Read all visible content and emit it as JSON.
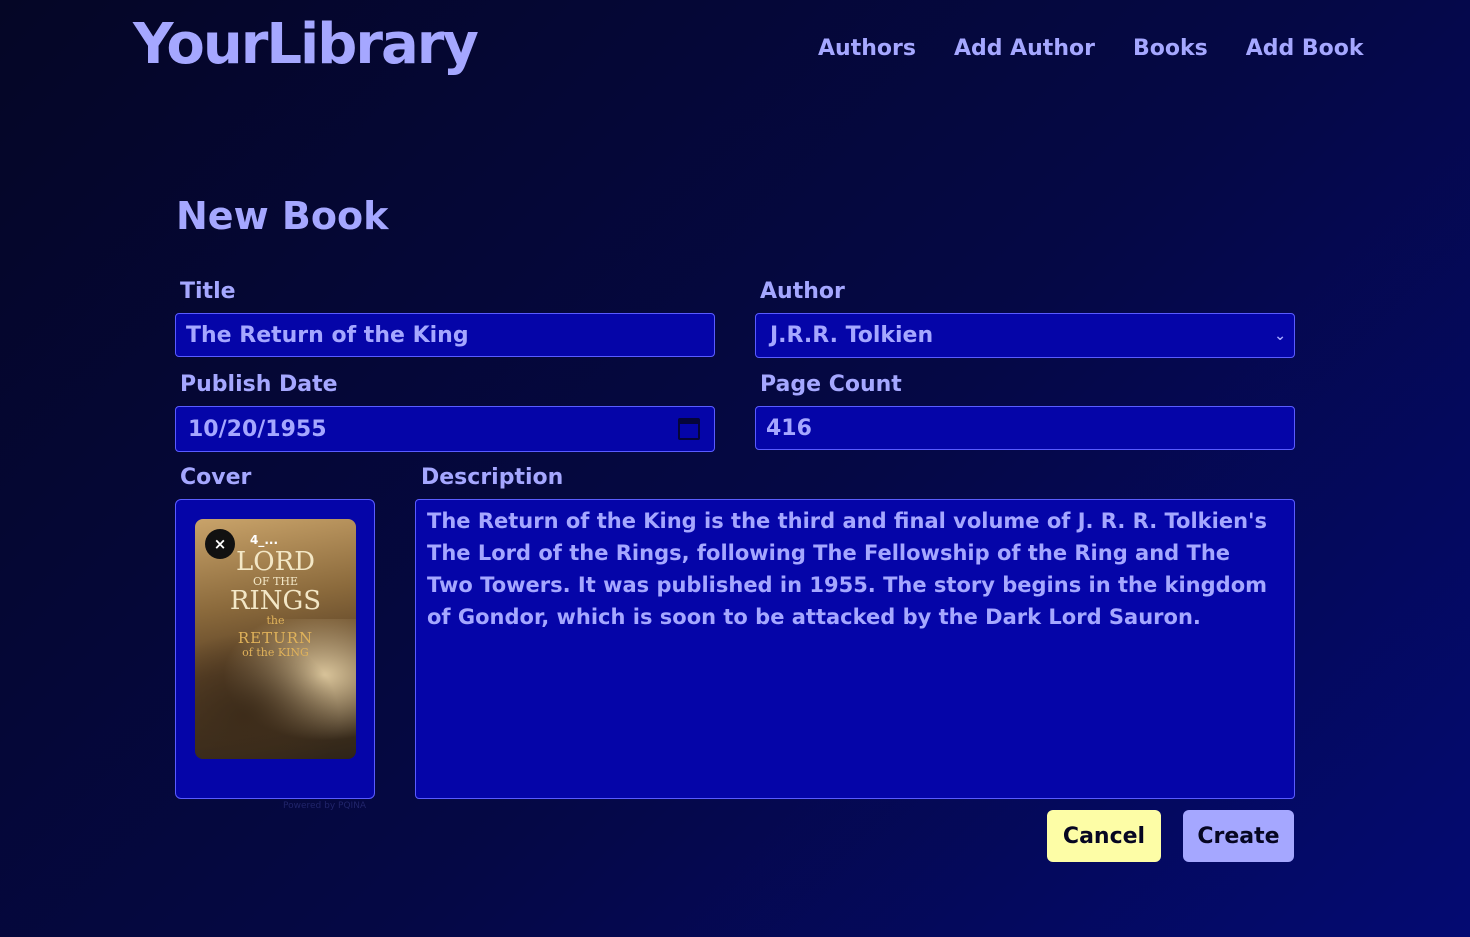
{
  "header": {
    "logo": "YourLibrary",
    "nav": [
      "Authors",
      "Add Author",
      "Books",
      "Add Book"
    ]
  },
  "page": {
    "title": "New Book"
  },
  "form": {
    "title_label": "Title",
    "title_value": "The Return of the King",
    "author_label": "Author",
    "author_value": "J.R.R. Tolkien",
    "publish_date_label": "Publish Date",
    "publish_date_value": "10/20/1955",
    "page_count_label": "Page Count",
    "page_count_value": "416",
    "cover_label": "Cover",
    "cover_file_name": "4_...",
    "cover_poster_lines": [
      "LORD",
      "OF THE",
      "RINGS",
      "the",
      "RETURN",
      "of the KING"
    ],
    "remove_icon": "×",
    "powered_by": "Powered by PQINA",
    "description_label": "Description",
    "description_value": "The Return of the King is the third and final volume of J. R. R. Tolkien's The Lord of the Rings, following The Fellowship of the Ring and The Two Towers. It was published in 1955. The story begins in the kingdom of Gondor, which is soon to be attacked by the Dark Lord Sauron."
  },
  "actions": {
    "cancel": "Cancel",
    "create": "Create"
  },
  "colors": {
    "accent": "#a5a7ff",
    "field_bg": "#0505a8",
    "cancel_bg": "#fdfda6",
    "create_bg": "#a5a7ff"
  }
}
